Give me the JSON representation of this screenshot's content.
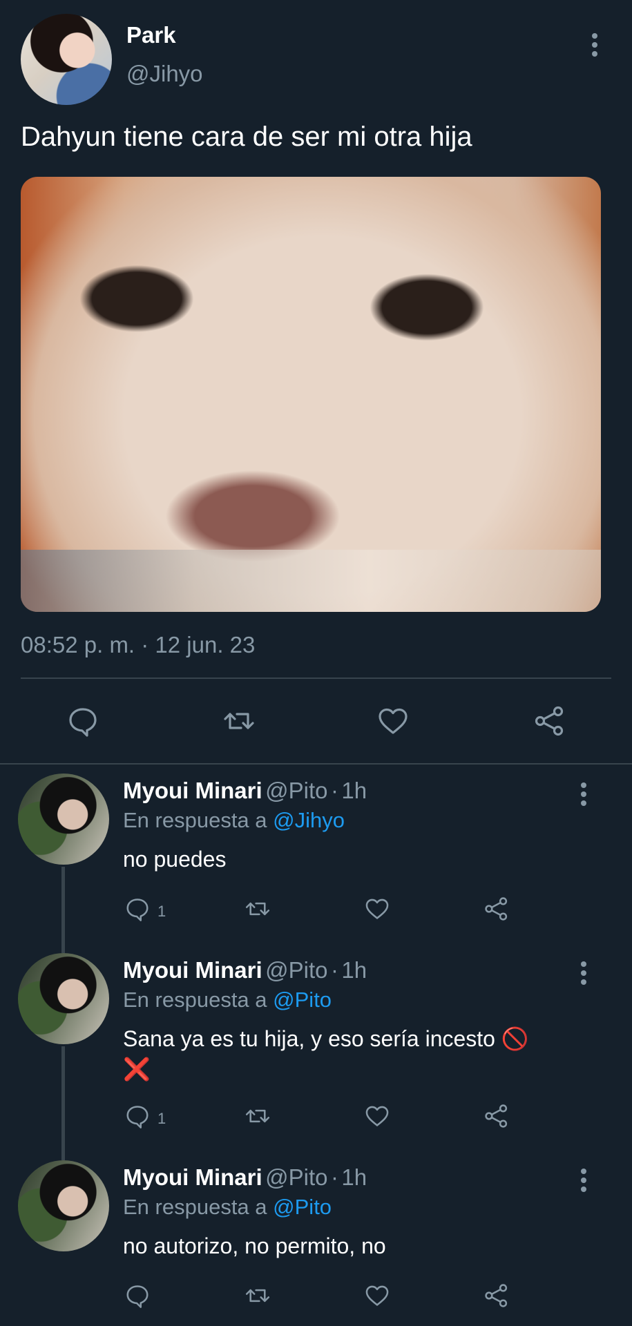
{
  "tweet": {
    "name": "Park",
    "handle": "@Jihyo",
    "text": "Dahyun tiene cara de ser mi otra hija",
    "timestamp": "08:52 p. m. · 12 jun. 23",
    "actions": [
      "reply-icon",
      "retweet-icon",
      "like-icon",
      "share-icon"
    ]
  },
  "replies": [
    {
      "name": "Myoui Minari",
      "handle": "@Pito",
      "sep": "·",
      "time": "1h",
      "reply_prefix": "En respuesta a",
      "reply_to": "@Jihyo",
      "text": "no puedes",
      "reply_count": "1"
    },
    {
      "name": "Myoui Minari",
      "handle": "@Pito",
      "sep": "·",
      "time": "1h",
      "reply_prefix": "En respuesta a",
      "reply_to": "@Pito",
      "text": "Sana ya es tu hija, y eso sería incesto 🚫",
      "text2": "❌",
      "reply_count": "1"
    },
    {
      "name": "Myoui Minari",
      "handle": "@Pito",
      "sep": "·",
      "time": "1h",
      "reply_prefix": "En respuesta a",
      "reply_to": "@Pito",
      "text": "no autorizo, no permito, no",
      "reply_count": ""
    }
  ],
  "colors": {
    "background": "#15202b",
    "secondary_text": "#8899a6",
    "mention": "#1d9bf0",
    "divider": "#38444d"
  }
}
